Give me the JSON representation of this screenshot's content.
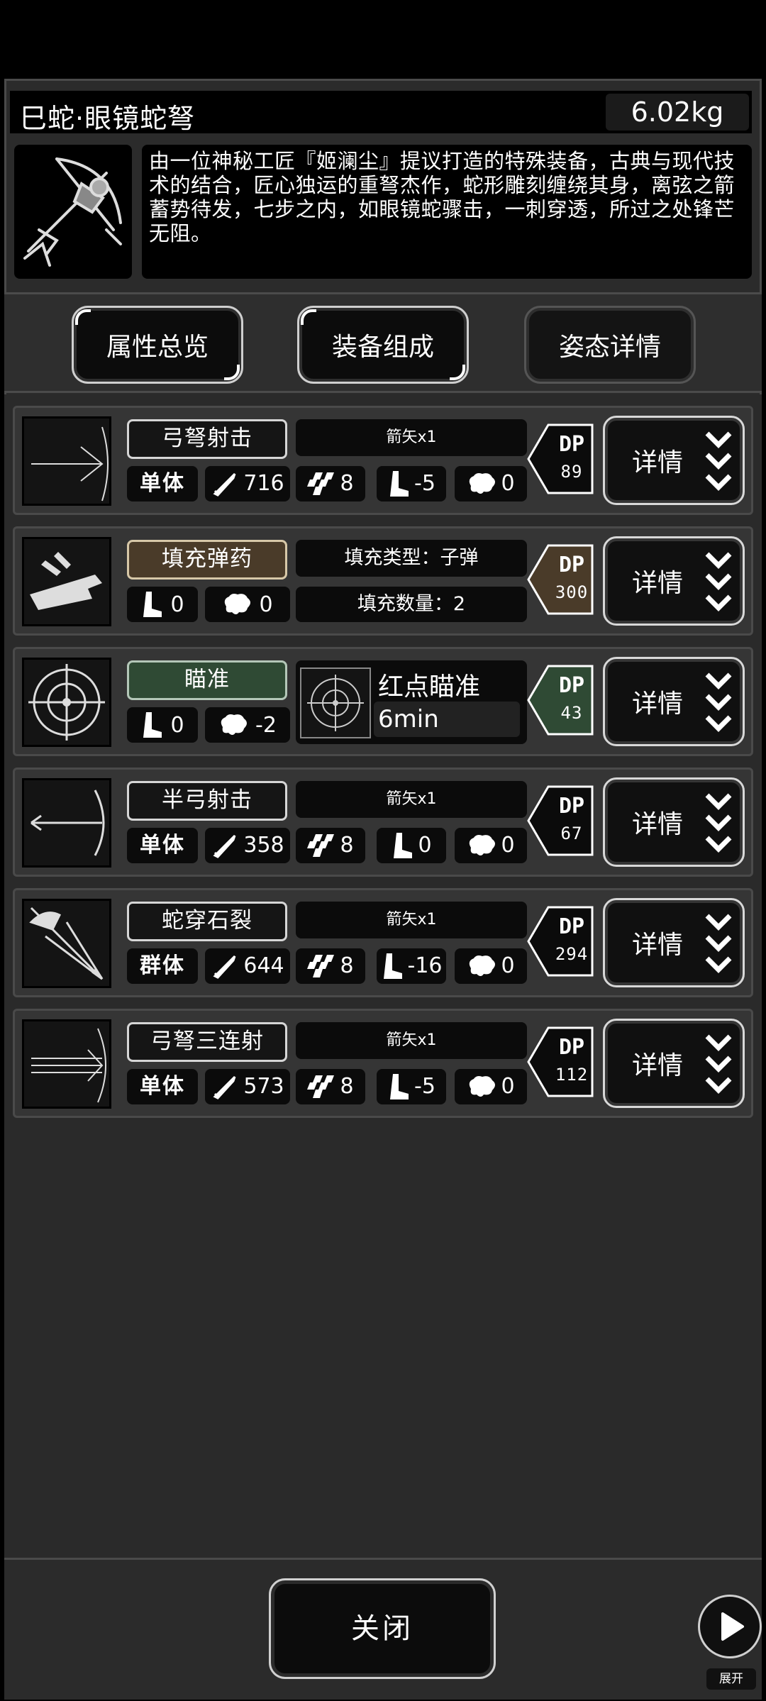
{
  "header": {
    "title": "巳蛇·眼镜蛇弩",
    "weight": "6.02kg",
    "description": "由一位神秘工匠『姬澜尘』提议打造的特殊装备，古典与现代技术的结合，匠心独运的重弩杰作，蛇形雕刻缠绕其身，离弦之箭蓄势待发，七步之内，如眼镜蛇骤击，一刺穿透，所过之处锋芒无阻。"
  },
  "tabs": [
    {
      "label": "属性总览"
    },
    {
      "label": "装备组成"
    },
    {
      "label": "姿态详情"
    }
  ],
  "skills": [
    {
      "name": "弓弩射击",
      "ammo": "箭矢x1",
      "target": "单体",
      "damage": "716",
      "accuracy": "8",
      "move": "-5",
      "mind": "0",
      "dp_label": "DP",
      "dp": "89",
      "detail": "详情"
    },
    {
      "name": "填充弹药",
      "fill_type": "填充类型：子弹",
      "fill_count": "填充数量：2",
      "move": "0",
      "mind": "0",
      "dp_label": "DP",
      "dp": "300",
      "detail": "详情"
    },
    {
      "name": "瞄准",
      "scope_name": "红点瞄准",
      "scope_time": "6min",
      "move": "0",
      "mind": "-2",
      "dp_label": "DP",
      "dp": "43",
      "detail": "详情"
    },
    {
      "name": "半弓射击",
      "ammo": "箭矢x1",
      "target": "单体",
      "damage": "358",
      "accuracy": "8",
      "move": "0",
      "mind": "0",
      "dp_label": "DP",
      "dp": "67",
      "detail": "详情"
    },
    {
      "name": "蛇穿石裂",
      "ammo": "箭矢x1",
      "target": "群体",
      "damage": "644",
      "accuracy": "8",
      "move": "-16",
      "mind": "0",
      "dp_label": "DP",
      "dp": "294",
      "detail": "详情"
    },
    {
      "name": "弓弩三连射",
      "ammo": "箭矢x1",
      "target": "单体",
      "damage": "573",
      "accuracy": "8",
      "move": "-5",
      "mind": "0",
      "dp_label": "DP",
      "dp": "112",
      "detail": "详情"
    }
  ],
  "footer": {
    "close_label": "关闭",
    "expand_label": "展开"
  },
  "colors": {
    "fill_brown": "#4a3b29",
    "aim_green": "#2f4a34",
    "panel": "#2b2b2b"
  }
}
